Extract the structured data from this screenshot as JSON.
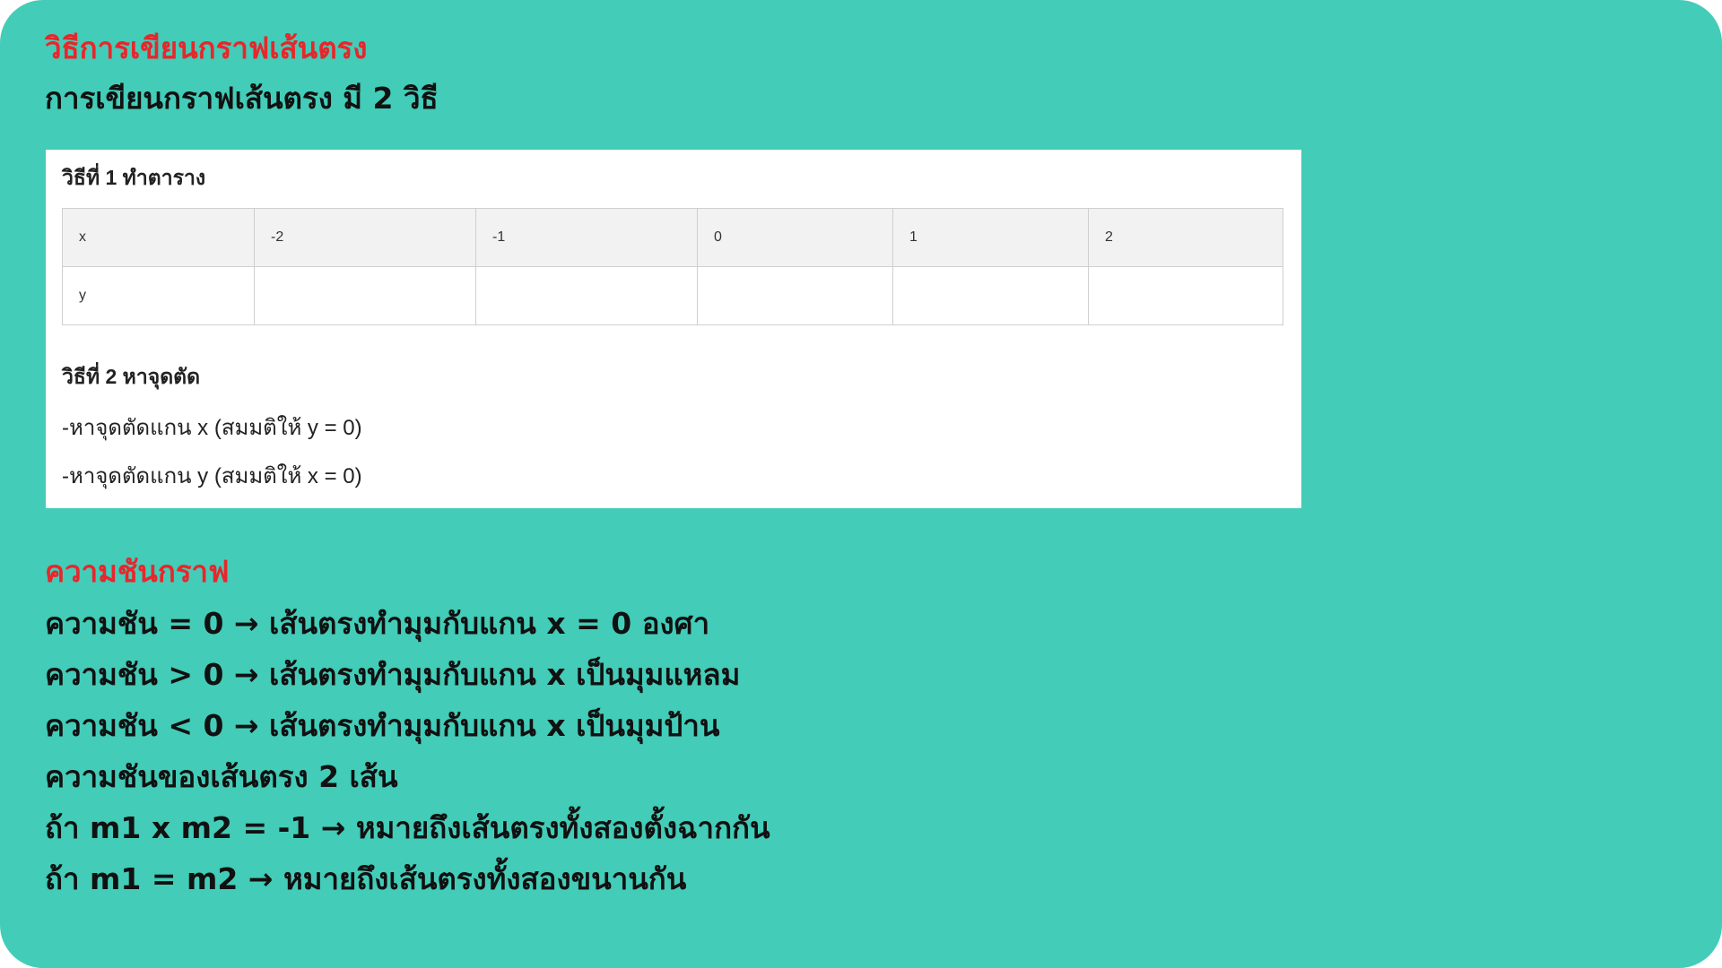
{
  "section1": {
    "title": "วิธีการเขียนกราฟเส้นตรง",
    "subtitle": "การเขียนกราฟเส้นตรง มี 2 วิธี"
  },
  "panel": {
    "method1_title": "วิธีที่ 1 ทำตาราง",
    "table": {
      "row_x": [
        "x",
        "-2",
        "-1",
        "0",
        "1",
        "2"
      ],
      "row_y": [
        "y",
        "",
        "",
        "",
        "",
        ""
      ]
    },
    "method2_title": "วิธีที่ 2 หาจุดตัด",
    "steps": [
      "-หาจุดตัดแกน x (สมมติให้ y = 0)",
      "-หาจุดตัดแกน y (สมมติให้ x = 0)"
    ]
  },
  "section2": {
    "title": "ความชันกราฟ",
    "lines": [
      "ความชัน = 0 → เส้นตรงทำมุมกับแกน x = 0 องศา",
      "ความชัน > 0 → เส้นตรงทำมุมกับแกน x เป็นมุมแหลม",
      "ความชัน < 0 → เส้นตรงทำมุมกับแกน x เป็นมุมป้าน",
      "ความชันของเส้นตรง 2 เส้น",
      "ถ้า m1 x m2 = -1 → หมายถึงเส้นตรงทั้งสองตั้งฉากกัน",
      "ถ้า m1 = m2 → หมายถึงเส้นตรงทั้งสองขนานกัน"
    ]
  },
  "colors": {
    "background": "#43ccb8",
    "heading_red": "#e8262b",
    "text_dark": "#111111",
    "table_header_bg": "#f2f2f2",
    "table_border": "#cfcfcf"
  }
}
